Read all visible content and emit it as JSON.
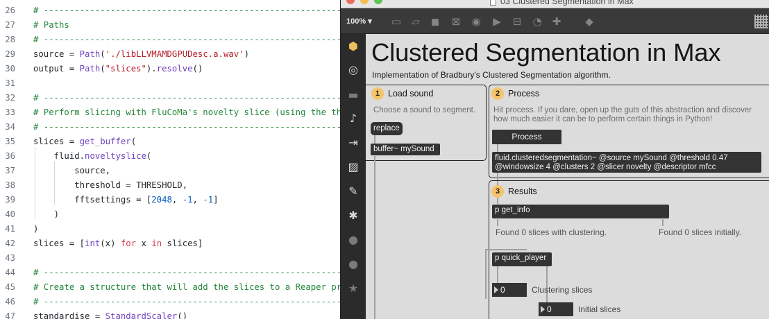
{
  "editor": {
    "lines": [
      {
        "no": "26",
        "tokens": [
          {
            "t": "# -----------------------------------------------------------------",
            "c": "c"
          }
        ]
      },
      {
        "no": "27",
        "tokens": [
          {
            "t": "# Paths",
            "c": "c"
          }
        ]
      },
      {
        "no": "28",
        "tokens": [
          {
            "t": "# -----------------------------------------------------------------",
            "c": "c"
          }
        ]
      },
      {
        "no": "29",
        "tokens": [
          {
            "t": "source = ",
            "c": ""
          },
          {
            "t": "Path",
            "c": "f"
          },
          {
            "t": "(",
            "c": ""
          },
          {
            "t": "'./libLLVMAMDGPUDesc.a.wav'",
            "c": "s"
          },
          {
            "t": ")",
            "c": ""
          }
        ]
      },
      {
        "no": "30",
        "tokens": [
          {
            "t": "output = ",
            "c": ""
          },
          {
            "t": "Path",
            "c": "f"
          },
          {
            "t": "(",
            "c": ""
          },
          {
            "t": "\"slices\"",
            "c": "s"
          },
          {
            "t": ").",
            "c": ""
          },
          {
            "t": "resolve",
            "c": "f"
          },
          {
            "t": "()",
            "c": ""
          }
        ]
      },
      {
        "no": "31",
        "tokens": []
      },
      {
        "no": "32",
        "tokens": [
          {
            "t": "# -----------------------------------------------------------------",
            "c": "c"
          }
        ]
      },
      {
        "no": "33",
        "tokens": [
          {
            "t": "# Perform slicing with FluCoMa's novelty slice (using the thres",
            "c": "c"
          }
        ]
      },
      {
        "no": "34",
        "tokens": [
          {
            "t": "# -----------------------------------------------------------------",
            "c": "c"
          }
        ]
      },
      {
        "no": "35",
        "tokens": [
          {
            "t": "slices = ",
            "c": ""
          },
          {
            "t": "get_buffer",
            "c": "f"
          },
          {
            "t": "(",
            "c": ""
          }
        ]
      },
      {
        "no": "36",
        "tokens": [
          {
            "t": "    fluid.",
            "c": ""
          },
          {
            "t": "noveltyslice",
            "c": "f"
          },
          {
            "t": "(",
            "c": ""
          }
        ]
      },
      {
        "no": "37",
        "tokens": [
          {
            "t": "        source,",
            "c": ""
          }
        ]
      },
      {
        "no": "38",
        "tokens": [
          {
            "t": "        threshold = THRESHOLD,",
            "c": ""
          }
        ]
      },
      {
        "no": "39",
        "tokens": [
          {
            "t": "        fftsettings = [",
            "c": ""
          },
          {
            "t": "2048",
            "c": "n"
          },
          {
            "t": ", ",
            "c": ""
          },
          {
            "t": "-1",
            "c": "n"
          },
          {
            "t": ", ",
            "c": ""
          },
          {
            "t": "-1",
            "c": "n"
          },
          {
            "t": "]",
            "c": ""
          }
        ]
      },
      {
        "no": "40",
        "tokens": [
          {
            "t": "    )",
            "c": ""
          }
        ]
      },
      {
        "no": "41",
        "tokens": [
          {
            "t": ")",
            "c": ""
          }
        ]
      },
      {
        "no": "42",
        "tokens": [
          {
            "t": "slices = [",
            "c": ""
          },
          {
            "t": "int",
            "c": "f"
          },
          {
            "t": "(x) ",
            "c": ""
          },
          {
            "t": "for",
            "c": "k"
          },
          {
            "t": " x ",
            "c": ""
          },
          {
            "t": "in",
            "c": "k"
          },
          {
            "t": " slices]",
            "c": ""
          }
        ]
      },
      {
        "no": "43",
        "tokens": []
      },
      {
        "no": "44",
        "tokens": [
          {
            "t": "# -----------------------------------------------------------------",
            "c": "c"
          }
        ]
      },
      {
        "no": "45",
        "tokens": [
          {
            "t": "# Create a structure that will add the slices to a Reaper proje",
            "c": "c"
          }
        ]
      },
      {
        "no": "46",
        "tokens": [
          {
            "t": "# -----------------------------------------------------------------",
            "c": "c"
          }
        ]
      },
      {
        "no": "47",
        "tokens": [
          {
            "t": "standardise = ",
            "c": ""
          },
          {
            "t": "StandardScaler",
            "c": "f"
          },
          {
            "t": "()",
            "c": ""
          }
        ]
      }
    ]
  },
  "max": {
    "window_title": "03 Clustered Segmentation in Max",
    "zoom": "100%",
    "patcher": {
      "title": "Clustered Segmentation in Max",
      "subtitle": "Implementation of Bradbury's Clustered Segmentation algorithm.",
      "step1": {
        "badge": "1",
        "label": "Load sound",
        "hint": "Choose a sound to segment.",
        "replace_msg": "replace",
        "buffer_obj": "buffer~ mySound"
      },
      "step2": {
        "badge": "2",
        "label": "Process",
        "hint": "Hit process. If you dare, open up the guts of this abstraction and discover how much easier it can be to perform certain things in Python!",
        "process_button": "Process",
        "object_line1": "fluid.clusteredsegmentation~ @source mySound @threshold 0.47",
        "object_line2": "@windowsize 4 @clusters 2 @slicer novelty @descriptor mfcc"
      },
      "step3": {
        "badge": "3",
        "label": "Results",
        "get_info_obj": "p get_info",
        "found_clustering": "Found 0 slices with clustering.",
        "found_initial": "Found 0 slices initially.",
        "player_obj": "p quick_player",
        "clustering_value": "0",
        "clustering_label": "Clustering slices",
        "initial_value": "0",
        "initial_label": "Initial slices"
      }
    }
  }
}
